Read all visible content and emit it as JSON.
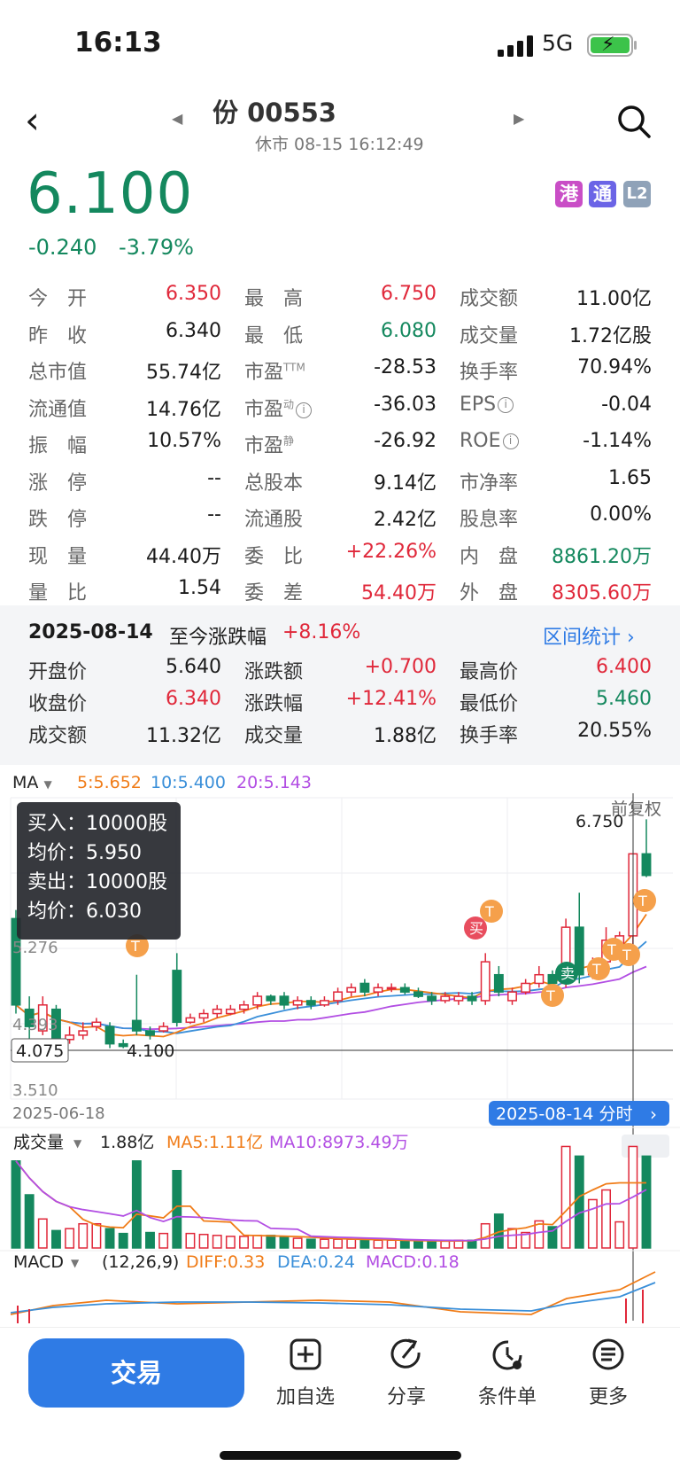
{
  "status_bar": {
    "time": "16:13",
    "network": "5G"
  },
  "header": {
    "title": "份 00553",
    "market_status": "休市 08-15 16:12:49"
  },
  "quote": {
    "price": "6.100",
    "change_abs": "-0.240",
    "change_pct": "-3.79%",
    "badges": [
      "港",
      "通",
      "L2"
    ]
  },
  "stats": {
    "col1": [
      {
        "label": "今　开",
        "value": "6.350"
      },
      {
        "label": "昨　收",
        "value": "6.340"
      },
      {
        "label": "总市值",
        "value": "55.74亿"
      },
      {
        "label": "流通值",
        "value": "14.76亿"
      },
      {
        "label": "振　幅",
        "value": "10.57%"
      },
      {
        "label": "涨　停",
        "value": "--"
      },
      {
        "label": "跌　停",
        "value": "--"
      },
      {
        "label": "现　量",
        "value": "44.40万"
      },
      {
        "label": "量　比",
        "value": "1.54"
      }
    ],
    "col2": [
      {
        "label": "最　高",
        "value": "6.750"
      },
      {
        "label": "最　低",
        "value": "6.080"
      },
      {
        "label": "市盈",
        "sup": "TTM",
        "value": "-28.53"
      },
      {
        "label": "市盈",
        "sup": "动",
        "value": "-36.03"
      },
      {
        "label": "市盈",
        "sup": "静",
        "value": "-26.92"
      },
      {
        "label": "总股本",
        "value": "9.14亿"
      },
      {
        "label": "流通股",
        "value": "2.42亿"
      },
      {
        "label": "委　比",
        "value": "+22.26%"
      },
      {
        "label": "委　差",
        "value": "54.40万"
      }
    ],
    "col3": [
      {
        "label": "成交额",
        "value": "11.00亿"
      },
      {
        "label": "成交量",
        "value": "1.72亿股"
      },
      {
        "label": "换手率",
        "value": "70.94%"
      },
      {
        "label": "EPS",
        "value": "-0.04"
      },
      {
        "label": "ROE",
        "value": "-1.14%"
      },
      {
        "label": "市净率",
        "value": "1.65"
      },
      {
        "label": "股息率",
        "value": "0.00%"
      },
      {
        "label": "内　盘",
        "value": "8861.20万"
      },
      {
        "label": "外　盘",
        "value": "8305.60万"
      }
    ]
  },
  "day_panel": {
    "date": "2025-08-14",
    "since_label": "至今涨跌幅",
    "since_value": "+8.16%",
    "range_stats_link": "区间统计",
    "rows": [
      [
        {
          "label": "开盘价",
          "value": "5.640"
        },
        {
          "label": "涨跌额",
          "value": "+0.700"
        },
        {
          "label": "最高价",
          "value": "6.400"
        }
      ],
      [
        {
          "label": "收盘价",
          "value": "6.340"
        },
        {
          "label": "涨跌幅",
          "value": "+12.41%"
        },
        {
          "label": "最低价",
          "value": "5.460"
        }
      ],
      [
        {
          "label": "成交额",
          "value": "11.32亿"
        },
        {
          "label": "成交量",
          "value": "1.88亿"
        },
        {
          "label": "换手率",
          "value": "20.55%"
        }
      ]
    ]
  },
  "chart_head": {
    "indicator": "MA",
    "ma5": "5:5.652",
    "ma10": "10:5.400",
    "ma20": "20:5.143"
  },
  "tooltip": [
    {
      "label": "买入：",
      "value": "10000股"
    },
    {
      "label": "均价：",
      "value": "5.950"
    },
    {
      "label": "卖出：",
      "value": "10000股"
    },
    {
      "label": "均价：",
      "value": "6.030"
    }
  ],
  "kline_labels": {
    "restore": "前复权",
    "high": "6.750",
    "low": "4.100",
    "price_tag": "4.075",
    "y_axis": [
      "5.276",
      "4.393",
      "3.510"
    ],
    "start_date": "2025-06-18",
    "current_date": "2025-08-14 分时"
  },
  "trade_marks": {
    "buy": "买",
    "sell": "卖",
    "t": "T"
  },
  "volume_head": {
    "indicator": "成交量",
    "value": "1.88亿",
    "ma5": "MA5:1.11亿",
    "ma10": "MA10:8973.49万"
  },
  "macd_head": {
    "indicator": "MACD",
    "params": "(12,26,9)",
    "diff": "DIFF:0.33",
    "dea": "DEA:0.24",
    "macd": "MACD:0.18"
  },
  "bottom_bar": {
    "trade": "交易",
    "tools": [
      {
        "label": "加自选",
        "icon": "add-watchlist-icon"
      },
      {
        "label": "分享",
        "icon": "share-icon"
      },
      {
        "label": "条件单",
        "icon": "conditional-order-icon"
      },
      {
        "label": "更多",
        "icon": "more-icon"
      }
    ]
  },
  "colors": {
    "up": "#e0283a",
    "down": "#14885e",
    "accent": "#2f7be5",
    "ma5": "#f07c18",
    "ma10": "#3a8fd9",
    "ma20": "#b24ee3"
  },
  "chart_data": {
    "type": "candlestick",
    "candles": [
      {
        "o": 5.6,
        "c": 4.6,
        "h": 5.7,
        "l": 4.5
      },
      {
        "o": 4.55,
        "c": 4.35,
        "h": 4.7,
        "l": 4.2
      },
      {
        "o": 4.3,
        "c": 4.6,
        "h": 4.7,
        "l": 4.25
      },
      {
        "o": 4.55,
        "c": 4.2,
        "h": 4.6,
        "l": 4.15
      },
      {
        "o": 4.2,
        "c": 4.25,
        "h": 4.35,
        "l": 4.15
      },
      {
        "o": 4.25,
        "c": 4.3,
        "h": 4.4,
        "l": 4.2
      },
      {
        "o": 4.35,
        "c": 4.4,
        "h": 4.45,
        "l": 4.3
      },
      {
        "o": 4.35,
        "c": 4.15,
        "h": 4.4,
        "l": 4.1
      },
      {
        "o": 4.15,
        "c": 4.12,
        "h": 4.2,
        "l": 4.1
      },
      {
        "o": 4.42,
        "c": 4.3,
        "h": 4.95,
        "l": 4.25
      },
      {
        "o": 4.3,
        "c": 4.25,
        "h": 4.35,
        "l": 4.2
      },
      {
        "o": 4.3,
        "c": 4.35,
        "h": 4.4,
        "l": 4.28
      },
      {
        "o": 5.0,
        "c": 4.4,
        "h": 5.2,
        "l": 4.35
      },
      {
        "o": 4.4,
        "c": 4.45,
        "h": 4.5,
        "l": 4.38
      },
      {
        "o": 4.45,
        "c": 4.5,
        "h": 4.55,
        "l": 4.4
      },
      {
        "o": 4.5,
        "c": 4.55,
        "h": 4.6,
        "l": 4.45
      },
      {
        "o": 4.5,
        "c": 4.55,
        "h": 4.6,
        "l": 4.48
      },
      {
        "o": 4.55,
        "c": 4.6,
        "h": 4.65,
        "l": 4.5
      },
      {
        "o": 4.6,
        "c": 4.7,
        "h": 4.75,
        "l": 4.55
      },
      {
        "o": 4.7,
        "c": 4.65,
        "h": 4.72,
        "l": 4.6
      },
      {
        "o": 4.7,
        "c": 4.6,
        "h": 4.75,
        "l": 4.55
      },
      {
        "o": 4.6,
        "c": 4.65,
        "h": 4.7,
        "l": 4.55
      },
      {
        "o": 4.65,
        "c": 4.6,
        "h": 4.7,
        "l": 4.55
      },
      {
        "o": 4.6,
        "c": 4.65,
        "h": 4.7,
        "l": 4.58
      },
      {
        "o": 4.65,
        "c": 4.75,
        "h": 4.8,
        "l": 4.6
      },
      {
        "o": 4.75,
        "c": 4.8,
        "h": 4.85,
        "l": 4.7
      },
      {
        "o": 4.85,
        "c": 4.75,
        "h": 4.9,
        "l": 4.7
      },
      {
        "o": 4.75,
        "c": 4.8,
        "h": 4.85,
        "l": 4.7
      },
      {
        "o": 4.8,
        "c": 4.8,
        "h": 4.85,
        "l": 4.75
      },
      {
        "o": 4.8,
        "c": 4.75,
        "h": 4.85,
        "l": 4.72
      },
      {
        "o": 4.75,
        "c": 4.7,
        "h": 4.8,
        "l": 4.68
      },
      {
        "o": 4.7,
        "c": 4.65,
        "h": 4.75,
        "l": 4.6
      },
      {
        "o": 4.65,
        "c": 4.7,
        "h": 4.75,
        "l": 4.62
      },
      {
        "o": 4.65,
        "c": 4.7,
        "h": 4.75,
        "l": 4.6
      },
      {
        "o": 4.7,
        "c": 4.65,
        "h": 4.75,
        "l": 4.6
      },
      {
        "o": 4.65,
        "c": 5.1,
        "h": 5.2,
        "l": 4.6
      },
      {
        "o": 4.95,
        "c": 4.75,
        "h": 5.05,
        "l": 4.7
      },
      {
        "o": 4.65,
        "c": 4.75,
        "h": 4.8,
        "l": 4.6
      },
      {
        "o": 4.75,
        "c": 4.85,
        "h": 4.9,
        "l": 4.72
      },
      {
        "o": 4.85,
        "c": 4.95,
        "h": 5.05,
        "l": 4.8
      },
      {
        "o": 4.95,
        "c": 4.85,
        "h": 5.0,
        "l": 4.8
      },
      {
        "o": 4.85,
        "c": 5.5,
        "h": 5.6,
        "l": 4.8
      },
      {
        "o": 5.5,
        "c": 4.95,
        "h": 5.9,
        "l": 4.85
      },
      {
        "o": 4.95,
        "c": 5.05,
        "h": 5.15,
        "l": 4.9
      },
      {
        "o": 5.1,
        "c": 5.35,
        "h": 5.5,
        "l": 5.05
      },
      {
        "o": 5.3,
        "c": 5.4,
        "h": 5.45,
        "l": 5.2
      },
      {
        "o": 5.4,
        "c": 6.35,
        "h": 6.35,
        "l": 5.3
      },
      {
        "o": 6.35,
        "c": 6.1,
        "h": 6.75,
        "l": 6.08
      }
    ],
    "volume": [
      9,
      5.5,
      3,
      1.8,
      2,
      2.5,
      2.5,
      2,
      1.5,
      9,
      1.6,
      1.5,
      8,
      1.5,
      1.4,
      1.3,
      1.2,
      1.2,
      1.3,
      1.3,
      1.1,
      1.0,
      0.9,
      0.9,
      0.9,
      0.9,
      0.8,
      0.8,
      0.8,
      0.7,
      0.7,
      0.7,
      0.7,
      0.8,
      0.8,
      2.5,
      3.5,
      2,
      1.6,
      2.8,
      2.2,
      10.5,
      9.5,
      5,
      6,
      2.7,
      10.5,
      9.5
    ],
    "y_range": [
      3.51,
      7.0
    ]
  }
}
